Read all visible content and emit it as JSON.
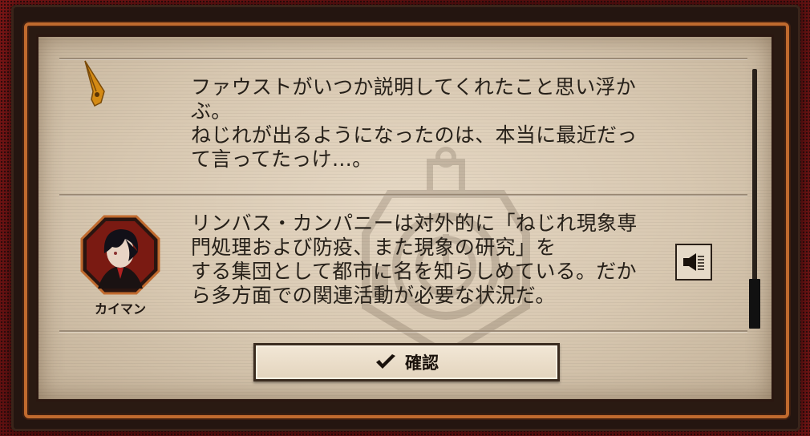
{
  "dialog": {
    "entries": [
      {
        "speaker": "",
        "lines": [
          "ファウストがいつか説明してくれたこと思い浮か",
          "ぶ。",
          "ねじれが出るようになったのは、本当に最近だっ",
          "て言ってたっけ…。"
        ]
      },
      {
        "speaker": "カイマン",
        "lines": [
          "リンバス・カンパニーは対外的に「ねじれ現象専",
          "門処理および防疫、また現象の研究」を",
          "する集団として都市に名を知らしめている。だか",
          "ら多方面での関連活動が必要な状況だ。"
        ]
      }
    ],
    "confirm_label": "確認"
  },
  "icons": {
    "narration": "pen-nib-icon",
    "voice": "speaker-icon",
    "confirm": "checkmark-icon"
  },
  "colors": {
    "frame_red": "#6e1414",
    "frame_orange": "#c06a2e",
    "panel_paper": "#d8c8b1",
    "text": "#262019",
    "pen_gold": "#d48a14"
  }
}
